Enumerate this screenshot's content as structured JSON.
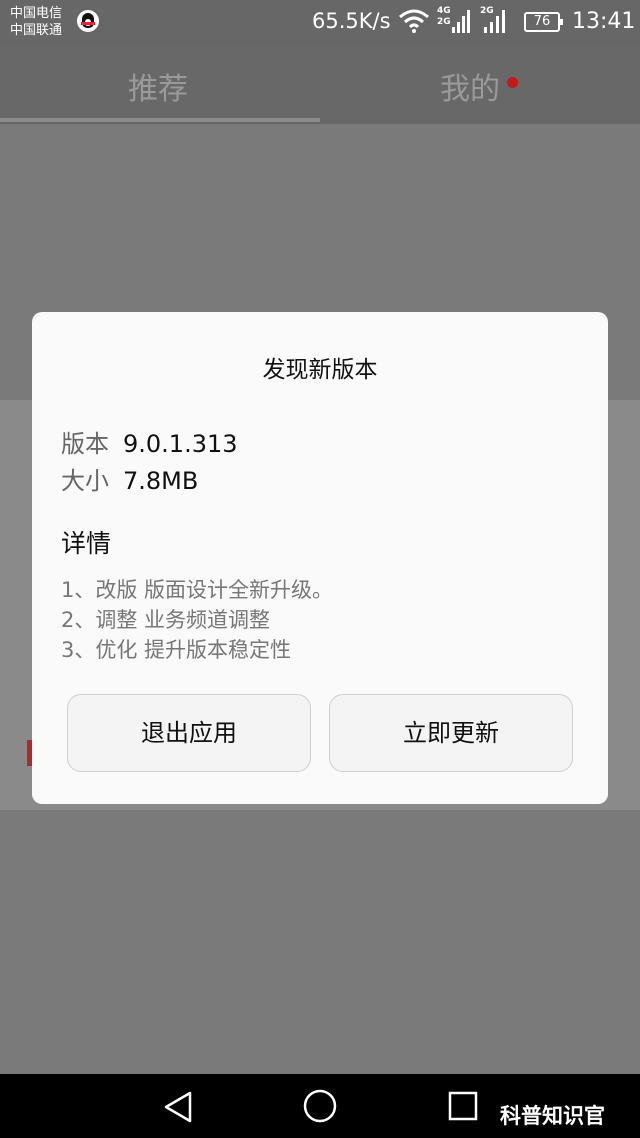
{
  "status_bar": {
    "carrier_1": "中国电信",
    "carrier_2": "中国联通",
    "network_speed": "65.5K/s",
    "net_type_1a": "4G",
    "net_type_1b": "2G",
    "net_type_2": "2G",
    "battery": "76",
    "time": "13:41"
  },
  "tabs": [
    {
      "label": "推荐",
      "selected": true
    },
    {
      "label": "我的",
      "has_badge": true
    }
  ],
  "dialog": {
    "title": "发现新版本",
    "version_label": "版本",
    "version_value": "9.0.1.313",
    "size_label": "大小",
    "size_value": "7.8MB",
    "details_heading": "详情",
    "changes": [
      "1、改版 版面设计全新升级。",
      "2、调整 业务频道调整",
      "3、优化 提升版本稳定性"
    ],
    "exit_button": "退出应用",
    "update_button": "立即更新"
  },
  "nav_bar": {
    "icons": [
      "back-icon",
      "home-icon",
      "recent-apps-icon"
    ]
  },
  "watermark": "科普知识官",
  "colors": {
    "overlay": "#7a7a7a",
    "dialog_bg": "#fafafa",
    "badge": "#c21a1a"
  }
}
